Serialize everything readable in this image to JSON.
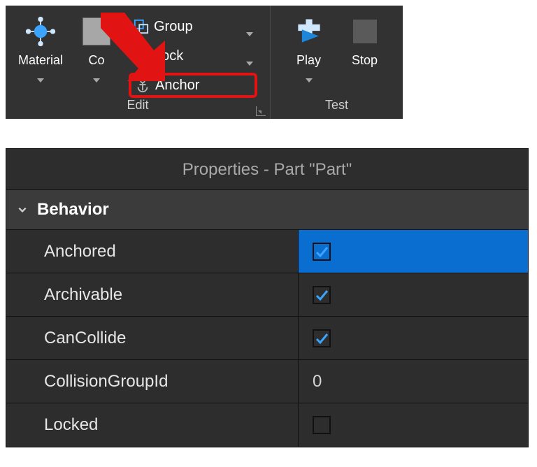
{
  "ribbon": {
    "material": {
      "label": "Material"
    },
    "color": {
      "label_visible": "Co"
    },
    "group": {
      "label": "Group"
    },
    "lock": {
      "label": "Lock"
    },
    "anchor": {
      "label": "Anchor"
    },
    "edit_group_label": "Edit",
    "play": {
      "label": "Play"
    },
    "stop": {
      "label": "Stop"
    },
    "test_group_label": "Test"
  },
  "properties": {
    "title": "Properties - Part \"Part\"",
    "section": "Behavior",
    "rows": {
      "anchored": {
        "label": "Anchored",
        "checked": true,
        "selected": true
      },
      "archivable": {
        "label": "Archivable",
        "checked": true,
        "selected": false
      },
      "cancollide": {
        "label": "CanCollide",
        "checked": true,
        "selected": false
      },
      "collisiongroupid": {
        "label": "CollisionGroupId",
        "value": "0"
      },
      "locked": {
        "label": "Locked",
        "checked": false,
        "selected": false
      }
    }
  },
  "colors": {
    "accent": "#0a6ed1",
    "check": "#3aa4ff",
    "highlight_red": "#e11313"
  }
}
